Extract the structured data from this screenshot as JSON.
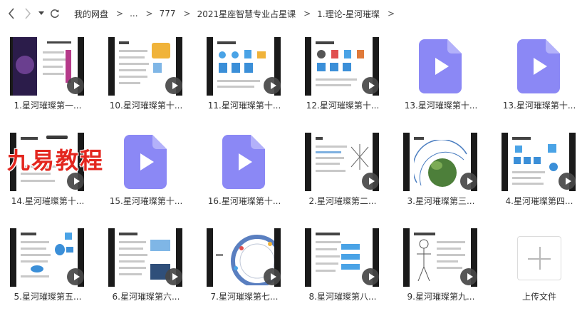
{
  "nav": {
    "breadcrumbs": [
      "我的网盘",
      "...",
      "777",
      "2021星座智慧专业占星课",
      "1.理论-星河璀璨"
    ],
    "separator": ">"
  },
  "files": [
    {
      "name": "1.星河璀璨第一...",
      "kind": "video-thumb"
    },
    {
      "name": "10.星河璀璨第十...",
      "kind": "video-thumb"
    },
    {
      "name": "11.星河璀璨第十...",
      "kind": "video-thumb"
    },
    {
      "name": "12.星河璀璨第十...",
      "kind": "video-thumb"
    },
    {
      "name": "13.星河璀璨第十...",
      "kind": "video-icon"
    },
    {
      "name": "13.星河璀璨第十...",
      "kind": "video-icon"
    },
    {
      "name": "14.星河璀璨第十...",
      "kind": "video-thumb"
    },
    {
      "name": "15.星河璀璨第十...",
      "kind": "video-icon"
    },
    {
      "name": "16.星河璀璨第十...",
      "kind": "video-icon"
    },
    {
      "name": "2.星河璀璨第二...",
      "kind": "video-thumb"
    },
    {
      "name": "3.星河璀璨第三...",
      "kind": "video-thumb"
    },
    {
      "name": "4.星河璀璨第四...",
      "kind": "video-thumb"
    },
    {
      "name": "5.星河璀璨第五...",
      "kind": "video-thumb"
    },
    {
      "name": "6.星河璀璨第六...",
      "kind": "video-thumb"
    },
    {
      "name": "7.星河璀璨第七...",
      "kind": "video-thumb"
    },
    {
      "name": "8.星河璀璨第八...",
      "kind": "video-thumb"
    },
    {
      "name": "9.星河璀璨第九...",
      "kind": "video-thumb"
    }
  ],
  "upload": {
    "label": "上传文件"
  },
  "watermark": "九易教程",
  "colors": {
    "file_icon": "#8b88f5",
    "watermark": "#e3261e",
    "play_overlay": "#464646"
  }
}
